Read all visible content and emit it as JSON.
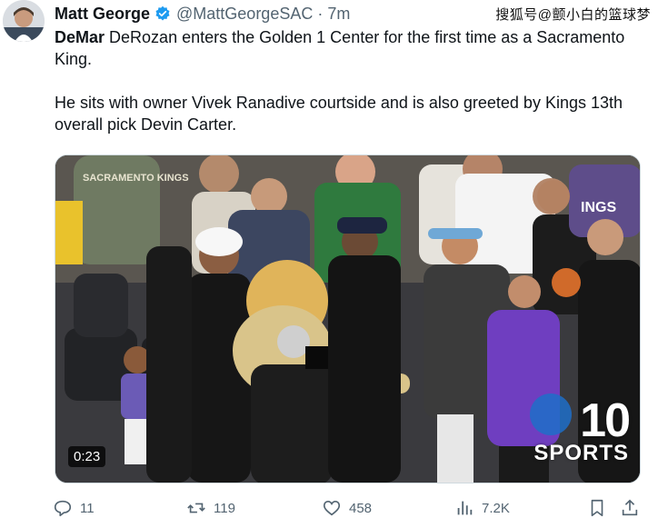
{
  "author": {
    "name": "Matt George",
    "handle": "@MattGeorgeSAC",
    "time": "7m",
    "verified_color": "#1d9bf0"
  },
  "watermark": "搜狐号@颤小白的篮球梦",
  "tweet": {
    "line1_bold": "DeMar",
    "line1_rest": " DeRozan enters the Golden 1 Center for the first time as a Sacramento King.",
    "line2": "He sits with owner Vivek Ranadive courtside and is also greeted by Kings 13th overall pick Devin Carter."
  },
  "media": {
    "duration": "0:23",
    "brand_channel": "10",
    "brand_sports": "SPORTS",
    "crowd_shirt_text": "SACRAMENTO KINGS",
    "jersey_text": "INGS"
  },
  "actions": {
    "replies": "11",
    "reposts": "119",
    "likes": "458",
    "views": "7.2K"
  },
  "colors": {
    "text": "#0f1419",
    "secondary": "#536471",
    "purple": "#6f3ec0"
  }
}
